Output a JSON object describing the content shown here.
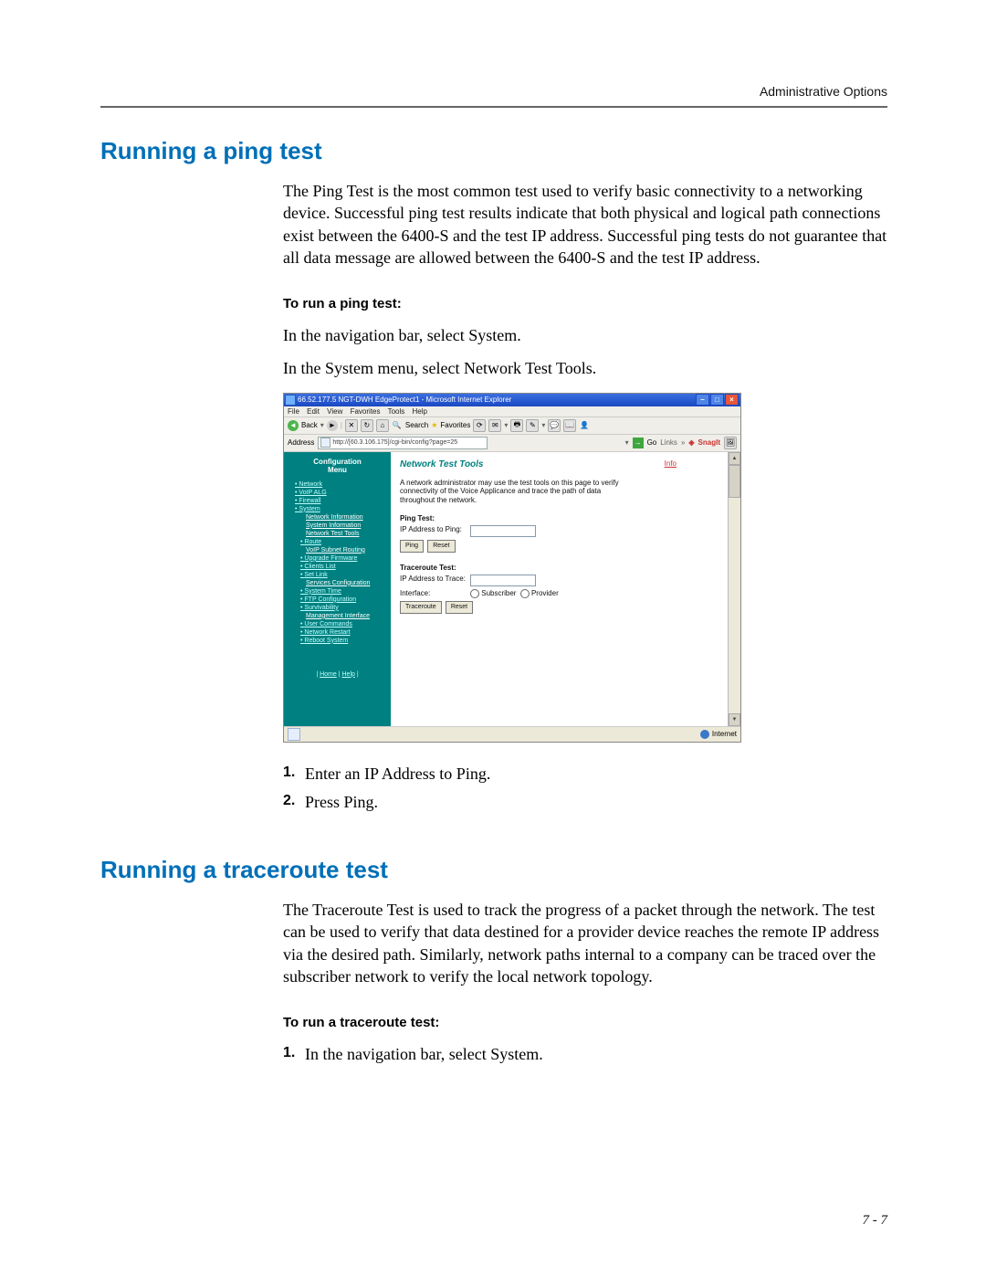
{
  "header_right": "Administrative Options",
  "section1": {
    "title": "Running a ping test",
    "para": "The Ping Test is the most common test used to verify basic connectivity to a networking device. Successful ping test results indicate that both physical and logical path connections exist between the 6400-S and the test IP address. Successful ping tests do not guarantee that all data message are allowed between the 6400-S and the test IP address.",
    "subhead": "To run a ping test:",
    "l1": "In the navigation bar, select System.",
    "l2": "In the System menu, select Network Test Tools.",
    "step1_n": "1.",
    "step1": "Enter an IP Address to Ping.",
    "step2_n": "2.",
    "step2": "Press Ping."
  },
  "section2": {
    "title": "Running a traceroute test",
    "para": "The Traceroute Test is used to track the progress of a packet through the network. The test can be used to verify that data destined for a provider device reaches the remote IP address via the desired path. Similarly, network paths internal to a company can be traced over the subscriber network to verify the local network topology.",
    "subhead": "To run a traceroute test:",
    "step1_n": "1.",
    "step1": "In the navigation bar, select System."
  },
  "page_number": "7 - 7",
  "ss": {
    "title": "66.52.177.5 NGT-DWH EdgeProtect1 - Microsoft Internet Explorer",
    "menu": {
      "file": "File",
      "edit": "Edit",
      "view": "View",
      "favorites": "Favorites",
      "tools": "Tools",
      "help": "Help"
    },
    "tb": {
      "back": "Back",
      "search": "Search",
      "favorites": "Favorites"
    },
    "addr_label": "Address",
    "addr": "http://[60.3.106.175]/cgi-bin/config?page=25",
    "go": "Go",
    "links": "Links",
    "snagit": "SnagIt",
    "side": {
      "h1": "Configuration",
      "h2": "Menu",
      "network": "Network",
      "voip": "VoIP ALG",
      "firewall": "Firewall",
      "system": "System",
      "netinfo": "Network Information",
      "sysinfo": "System Information",
      "ntt": "Network Test Tools",
      "route": "Route",
      "voipsub": "VoIP Subnet Routing",
      "upgrade": "Upgrade Firmware",
      "clients": "Clients List",
      "setlink": "Set Link",
      "services": "Services Configuration",
      "systime": "System Time",
      "ftpconf": "FTP Configuration",
      "surviv": "Survivability",
      "mgmtif": "Management Interface",
      "usercmds": "User Commands",
      "netrestart": "Network Restart",
      "reboot": "Reboot System",
      "home": "Home",
      "help": "Help"
    },
    "main": {
      "info": "Info",
      "title": "Network Test Tools",
      "desc": "A network administrator may use the test tools on this page to verify connectivity of the Voice Applicance and trace the path of data throughout the network.",
      "ping_h": "Ping Test:",
      "ping_lbl": "IP Address to Ping:",
      "ping_btn": "Ping",
      "reset": "Reset",
      "trace_h": "Traceroute Test:",
      "trace_lbl": "IP Address to Trace:",
      "iface_lbl": "Interface:",
      "sub": "Subscriber",
      "prov": "Provider",
      "trace_btn": "Traceroute"
    },
    "status": "Internet"
  }
}
